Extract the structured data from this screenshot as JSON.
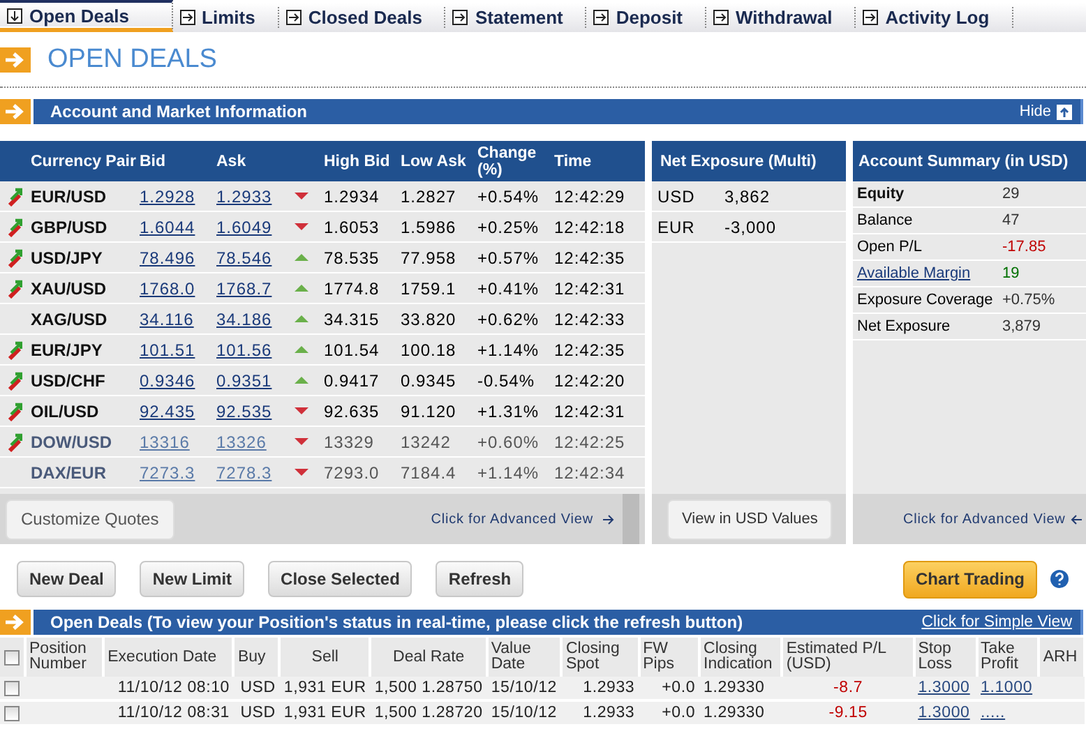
{
  "tabs": [
    {
      "label": "Open Deals",
      "selected": true
    },
    {
      "label": "Limits",
      "selected": false
    },
    {
      "label": "Closed Deals",
      "selected": false
    },
    {
      "label": "Statement",
      "selected": false
    },
    {
      "label": "Deposit",
      "selected": false
    },
    {
      "label": "Withdrawal",
      "selected": false
    },
    {
      "label": "Activity Log",
      "selected": false
    }
  ],
  "page_title": "OPEN DEALS",
  "market_section": {
    "title": "Account and Market Information",
    "hide_label": "Hide"
  },
  "quotes": {
    "columns": [
      "Currency Pair",
      "Bid",
      "Ask",
      "High Bid",
      "Low Ask",
      "Change (%)",
      "Time"
    ],
    "rows": [
      {
        "tradable": true,
        "disabled": false,
        "pair": "EUR/USD",
        "bid": "1.2928",
        "ask": "1.2933",
        "rising": false,
        "high_bid": "1.2934",
        "low_ask": "1.2827",
        "change": "+0.54%",
        "time": "12:42:29"
      },
      {
        "tradable": true,
        "disabled": false,
        "pair": "GBP/USD",
        "bid": "1.6044",
        "ask": "1.6049",
        "rising": false,
        "high_bid": "1.6053",
        "low_ask": "1.5986",
        "change": "+0.25%",
        "time": "12:42:18"
      },
      {
        "tradable": true,
        "disabled": false,
        "pair": "USD/JPY",
        "bid": "78.496",
        "ask": "78.546",
        "rising": true,
        "high_bid": "78.535",
        "low_ask": "77.958",
        "change": "+0.57%",
        "time": "12:42:35"
      },
      {
        "tradable": true,
        "disabled": false,
        "pair": "XAU/USD",
        "bid": "1768.0",
        "ask": "1768.7",
        "rising": true,
        "high_bid": "1774.8",
        "low_ask": "1759.1",
        "change": "+0.41%",
        "time": "12:42:31"
      },
      {
        "tradable": false,
        "disabled": false,
        "pair": "XAG/USD",
        "bid": "34.116",
        "ask": "34.186",
        "rising": true,
        "high_bid": "34.315",
        "low_ask": "33.820",
        "change": "+0.62%",
        "time": "12:42:33"
      },
      {
        "tradable": true,
        "disabled": false,
        "pair": "EUR/JPY",
        "bid": "101.51",
        "ask": "101.56",
        "rising": true,
        "high_bid": "101.54",
        "low_ask": "100.18",
        "change": "+1.14%",
        "time": "12:42:35"
      },
      {
        "tradable": true,
        "disabled": false,
        "pair": "USD/CHF",
        "bid": "0.9346",
        "ask": "0.9351",
        "rising": true,
        "high_bid": "0.9417",
        "low_ask": "0.9345",
        "change": "-0.54%",
        "time": "12:42:20"
      },
      {
        "tradable": true,
        "disabled": false,
        "pair": "OIL/USD",
        "bid": "92.435",
        "ask": "92.535",
        "rising": false,
        "high_bid": "92.635",
        "low_ask": "91.120",
        "change": "+1.31%",
        "time": "12:42:31"
      },
      {
        "tradable": true,
        "disabled": true,
        "pair": "DOW/USD",
        "bid": "13316",
        "ask": "13326",
        "rising": false,
        "high_bid": "13329",
        "low_ask": "13242",
        "change": "+0.60%",
        "time": "12:42:25"
      },
      {
        "tradable": false,
        "disabled": true,
        "pair": "DAX/EUR",
        "bid": "7273.3",
        "ask": "7278.3",
        "rising": false,
        "high_bid": "7293.0",
        "low_ask": "7184.4",
        "change": "+1.14%",
        "time": "12:42:34"
      }
    ],
    "customize_button": "Customize Quotes",
    "advanced_link": "Click for Advanced View"
  },
  "net_exposure": {
    "title": "Net Exposure (Multi)",
    "rows": [
      {
        "currency": "USD",
        "amount": "3,862"
      },
      {
        "currency": "EUR",
        "amount": "-3,000"
      }
    ],
    "usd_button": "View in USD Values"
  },
  "account_summary": {
    "title": "Account Summary (in USD)",
    "rows": [
      {
        "kind": "bold",
        "label": "Equity",
        "value": "29",
        "color": "#333333"
      },
      {
        "kind": "plain",
        "label": "Balance",
        "value": "47",
        "color": "#333333"
      },
      {
        "kind": "plain",
        "label": "Open P/L",
        "value": "-17.85",
        "color": "#c00000"
      },
      {
        "kind": "link",
        "label": "Available Margin",
        "value": "19",
        "color": "#007000"
      },
      {
        "kind": "plain",
        "label": "Exposure Coverage",
        "value": "+0.75%",
        "color": "#333333"
      },
      {
        "kind": "plain",
        "label": "Net Exposure",
        "value": "3,879",
        "color": "#333333"
      }
    ],
    "advanced_link": "Click for Advanced View"
  },
  "actions": [
    "New Deal",
    "New Limit",
    "Close Selected",
    "Refresh"
  ],
  "chart_trading": "Chart Trading",
  "deals_section": {
    "title": "Open Deals (To view your Position's status in real-time, please click the refresh button)",
    "simple_view_link": "Click for Simple View"
  },
  "deals": {
    "select_all_checked": false,
    "columns": [
      "Position Number",
      "Execution Date",
      "Buy",
      "Sell",
      "Deal Rate",
      "Value Date",
      "Closing Spot",
      "FW Pips",
      "Closing Indication",
      "Estimated P/L (USD)",
      "Stop Loss",
      "Take Profit",
      "ARH"
    ],
    "rows": [
      {
        "checked": false,
        "execution_date": "11/10/12 08:10",
        "buy": "USD",
        "sell": "1,931 EUR",
        "amount": "1,500",
        "deal_rate": "1.28750",
        "value_date": "15/10/12",
        "closing_spot": "1.2933",
        "fw_pips": "+0.0",
        "closing_indication": "1.29330",
        "estimated_pl": "-8.7",
        "stop_loss": "1.3000",
        "take_profit": "1.1000"
      },
      {
        "checked": false,
        "execution_date": "11/10/12 08:31",
        "buy": "USD",
        "sell": "1,931 EUR",
        "amount": "1,500",
        "deal_rate": "1.28720",
        "value_date": "15/10/12",
        "closing_spot": "1.2933",
        "fw_pips": "+0.0",
        "closing_indication": "1.29330",
        "estimated_pl": "-9.15",
        "stop_loss": "1.3000",
        "take_profit": "....."
      }
    ]
  }
}
